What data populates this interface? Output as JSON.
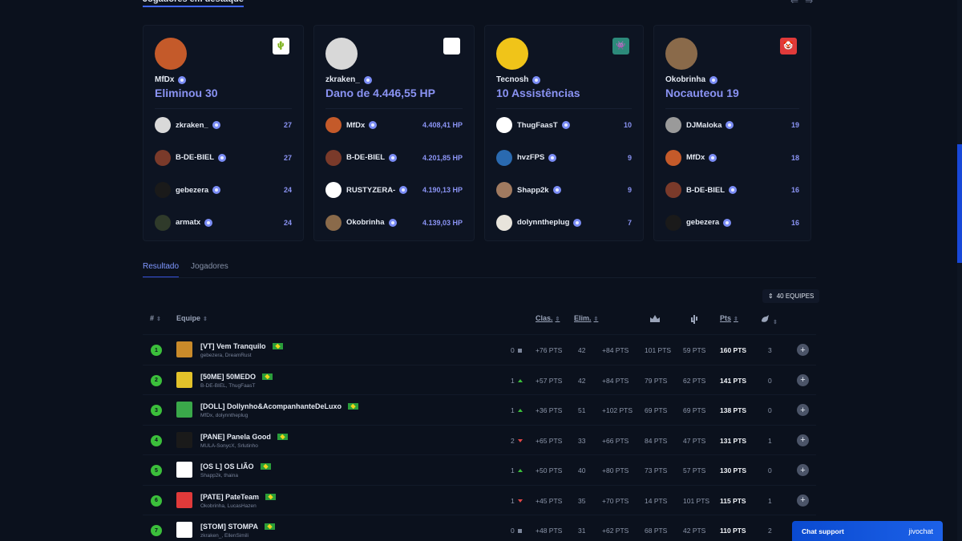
{
  "section_title": "Jogadores em destaque",
  "top_arrows": [
    "⇐",
    "⇒"
  ],
  "cards": [
    {
      "leader": "MfDx",
      "stat": "Eliminou 30",
      "avatar_color": "#c45a2a",
      "logo_color": "#ffffff",
      "logo_glyph": "🌵",
      "rows": [
        {
          "name": "zkraken_",
          "value": "27",
          "avatar_color": "#d9d9d9"
        },
        {
          "name": "B-DE-BIEL",
          "value": "27",
          "avatar_color": "#7a3a2a"
        },
        {
          "name": "gebezera",
          "value": "24",
          "avatar_color": "#1a1a1a"
        },
        {
          "name": "armatx",
          "value": "24",
          "avatar_color": "#2f3a2a"
        }
      ]
    },
    {
      "leader": "zkraken_",
      "stat": "Dano de 4.446,55 HP",
      "avatar_color": "#d8d8d8",
      "logo_color": "#ffffff",
      "logo_glyph": "",
      "rows": [
        {
          "name": "MfDx",
          "value": "4.408,41 HP",
          "avatar_color": "#c45a2a"
        },
        {
          "name": "B-DE-BIEL",
          "value": "4.201,85 HP",
          "avatar_color": "#7a3a2a"
        },
        {
          "name": "RUSTYZERA-",
          "value": "4.190,13 HP",
          "avatar_color": "#ffffff"
        },
        {
          "name": "Okobrinha",
          "value": "4.139,03 HP",
          "avatar_color": "#8a6a4a"
        }
      ]
    },
    {
      "leader": "Tecnosh",
      "stat": "10 Assistências",
      "avatar_color": "#f0c419",
      "logo_color": "#2c8a7a",
      "logo_glyph": "👾",
      "rows": [
        {
          "name": "ThugFaasT",
          "value": "10",
          "avatar_color": "#ffffff"
        },
        {
          "name": "hvzFPS",
          "value": "9",
          "avatar_color": "#2a6ab0"
        },
        {
          "name": "Shapp2k",
          "value": "9",
          "avatar_color": "#a07a60"
        },
        {
          "name": "dolynntheplug",
          "value": "7",
          "avatar_color": "#e8e4dc"
        }
      ]
    },
    {
      "leader": "Okobrinha",
      "stat": "Nocauteou 19",
      "avatar_color": "#8a6a4a",
      "logo_color": "#e03a3a",
      "logo_glyph": "🤡",
      "rows": [
        {
          "name": "DJMaloka",
          "value": "19",
          "avatar_color": "#9a9a9a"
        },
        {
          "name": "MfDx",
          "value": "18",
          "avatar_color": "#c45a2a"
        },
        {
          "name": "B-DE-BIEL",
          "value": "16",
          "avatar_color": "#7a3a2a"
        },
        {
          "name": "gebezera",
          "value": "16",
          "avatar_color": "#1a1a1a"
        }
      ]
    }
  ],
  "tabs": [
    "Resultado",
    "Jogadores"
  ],
  "teams_count": "40 EQUIPES",
  "headers": {
    "num": "#",
    "team": "Equipe",
    "clas": "Clas.",
    "elim": "Elim."
  },
  "header_icons": [
    "crown-icon",
    "cactus-icon",
    "chicken-icon"
  ],
  "rows": [
    {
      "num": "1",
      "name": "[VT] Vem Tranquilo",
      "players": "gebezera, DreamRust",
      "change": "0",
      "trend": "same",
      "pos_pts": "+76 PTS",
      "elims": "42",
      "elim_pts": "+84 PTS",
      "a": "101 PTS",
      "b": "59 PTS",
      "pts": "160 PTS",
      "extra": "3",
      "logo_color": "#c98a2a"
    },
    {
      "num": "2",
      "name": "[50ME] 50MEDO",
      "players": "B-DE-BIEL, ThugFaasT",
      "change": "1",
      "trend": "up",
      "pos_pts": "+57 PTS",
      "elims": "42",
      "elim_pts": "+84 PTS",
      "a": "79 PTS",
      "b": "62 PTS",
      "pts": "141 PTS",
      "extra": "0",
      "logo_color": "#e3c22a"
    },
    {
      "num": "3",
      "name": "[DOLL] Dollynho&AcompanhanteDeLuxo",
      "players": "MfDx, dolynntheplug",
      "change": "1",
      "trend": "up",
      "pos_pts": "+36 PTS",
      "elims": "51",
      "elim_pts": "+102 PTS",
      "a": "69 PTS",
      "b": "69 PTS",
      "pts": "138 PTS",
      "extra": "0",
      "logo_color": "#3aa84a"
    },
    {
      "num": "4",
      "name": "[PANE] Panela Good",
      "players": "MULA-SonycX, Srlutinho",
      "change": "2",
      "trend": "down",
      "pos_pts": "+65 PTS",
      "elims": "33",
      "elim_pts": "+66 PTS",
      "a": "84 PTS",
      "b": "47 PTS",
      "pts": "131 PTS",
      "extra": "1",
      "logo_color": "#1a1a1a"
    },
    {
      "num": "5",
      "name": "[OS L] OS LIÃO",
      "players": "Shapp2k, thaina",
      "change": "1",
      "trend": "up",
      "pos_pts": "+50 PTS",
      "elims": "40",
      "elim_pts": "+80 PTS",
      "a": "73 PTS",
      "b": "57 PTS",
      "pts": "130 PTS",
      "extra": "0",
      "logo_color": "#ffffff"
    },
    {
      "num": "6",
      "name": "[PATE] PateTeam",
      "players": "Okobrinha, LucasHazen",
      "change": "1",
      "trend": "down",
      "pos_pts": "+45 PTS",
      "elims": "35",
      "elim_pts": "+70 PTS",
      "a": "14 PTS",
      "b": "101 PTS",
      "pts": "115 PTS",
      "extra": "1",
      "logo_color": "#e03a3a"
    },
    {
      "num": "7",
      "name": "[STOM] STOMPA",
      "players": "zkraken_, EllenSimili",
      "change": "0",
      "trend": "same",
      "pos_pts": "+48 PTS",
      "elims": "31",
      "elim_pts": "+62 PTS",
      "a": "68 PTS",
      "b": "42 PTS",
      "pts": "110 PTS",
      "extra": "2",
      "logo_color": "#ffffff"
    }
  ],
  "chat": {
    "label": "Chat support",
    "brand": "jivochat"
  }
}
